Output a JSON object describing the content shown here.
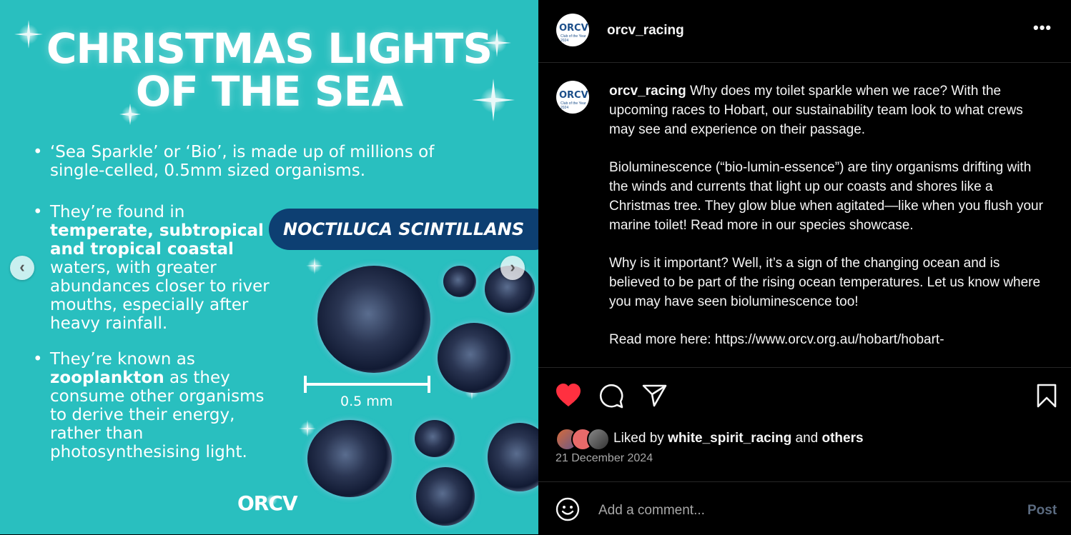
{
  "media": {
    "title_line1": "CHRISTMAS LIGHTS",
    "title_line2": "OF THE SEA",
    "bullet1": "‘Sea Sparkle’ or ‘Bio’, is made up of millions of single-celled, 0.5mm sized organisms.",
    "bullet2_pre": "They’re found in ",
    "bullet2_bold": "temperate, subtropical and tropical coastal",
    "bullet2_post": " waters, with greater abundances closer to river mouths, especially after heavy rainfall.",
    "bullet3_pre": "They’re known as ",
    "bullet3_bold": "zooplankton",
    "bullet3_post": " as they consume other organisms to derive their energy, rather than photosynthesising light.",
    "species_label": "NOCTILUCA SCINTILLANS",
    "scale_label": "0.5 mm",
    "logo_text": "ORCV",
    "prev_glyph": "‹",
    "next_glyph": "›"
  },
  "post": {
    "username": "orcv_racing",
    "more_glyph": "•••",
    "avatar_text": "ORCV",
    "avatar_sub": "Club of the Year 2024",
    "caption_username": "orcv_racing",
    "caption_p1": " Why does my toilet sparkle when we race? With the upcoming races to Hobart, our sustainability team look to what crews may see and experience on their passage.",
    "caption_p2": "Bioluminescence (“bio-lumin-essence”) are tiny organisms drifting with the winds and currents that light up our coasts and shores like a Christmas tree. They glow blue when agitated—like when you flush your marine toilet! Read more in our species showcase.",
    "caption_p3": "Why is it important? Well, it’s a sign of the changing ocean and is believed to be part of the rising ocean temperatures. Let us know where you may have seen bioluminescence too!",
    "caption_p4": "Read more here: https://www.orcv.org.au/hobart/hobart-",
    "liked_by_prefix": "Liked by ",
    "liked_by_user": "white_spirit_racing",
    "liked_by_and": " and ",
    "liked_by_others": "others",
    "date": "21 December 2024",
    "comment_placeholder": "Add a comment...",
    "post_button": "Post"
  },
  "colors": {
    "media_bg": "#29bfbf",
    "species_pill": "#0d3f72",
    "like_red": "#ff3040",
    "post_disabled": "#5b6b80"
  },
  "icons": [
    "heart-icon",
    "comment-icon",
    "share-icon",
    "bookmark-icon",
    "emoji-icon",
    "more-icon",
    "chevron-left-icon",
    "chevron-right-icon"
  ]
}
